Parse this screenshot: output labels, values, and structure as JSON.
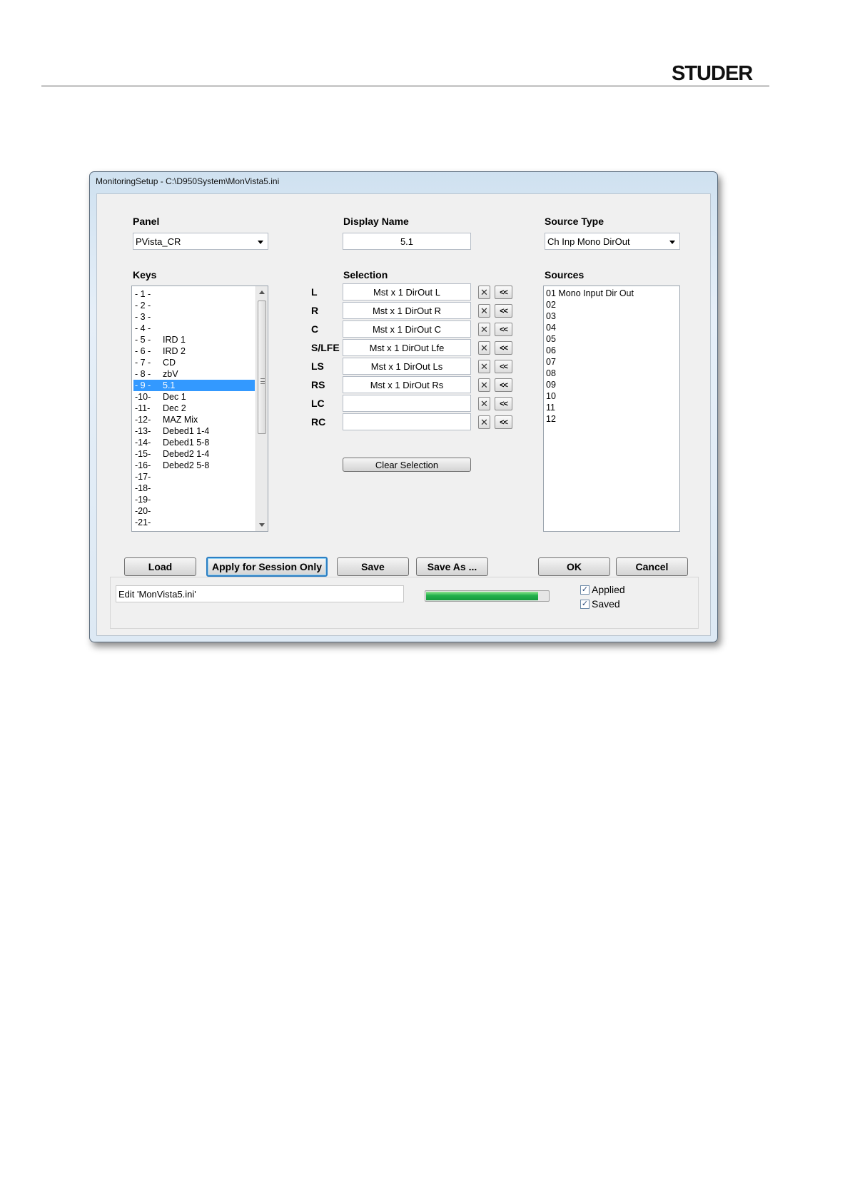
{
  "brand": {
    "logo_text": "STUDER"
  },
  "window": {
    "title": "MonitoringSetup - C:\\D950System\\MonVista5.ini"
  },
  "panel": {
    "label": "Panel",
    "value": "PVista_CR"
  },
  "display_name": {
    "label": "Display Name",
    "value": "5.1"
  },
  "source_type": {
    "label": "Source Type",
    "value": "Ch Inp Mono DirOut"
  },
  "keys": {
    "label": "Keys",
    "items": [
      {
        "num": "- 1 -",
        "name": ""
      },
      {
        "num": "- 2 -",
        "name": ""
      },
      {
        "num": "- 3 -",
        "name": ""
      },
      {
        "num": "- 4 -",
        "name": ""
      },
      {
        "num": "- 5 -",
        "name": "IRD 1"
      },
      {
        "num": "- 6 -",
        "name": "IRD 2"
      },
      {
        "num": "- 7 -",
        "name": "CD"
      },
      {
        "num": "- 8 -",
        "name": "zbV"
      },
      {
        "num": "- 9 -",
        "name": "5.1",
        "selected": true
      },
      {
        "num": "-10-",
        "name": "Dec 1"
      },
      {
        "num": "-11-",
        "name": "Dec 2"
      },
      {
        "num": "-12-",
        "name": "MAZ Mix"
      },
      {
        "num": "-13-",
        "name": "Debed1 1-4"
      },
      {
        "num": "-14-",
        "name": "Debed1 5-8"
      },
      {
        "num": "-15-",
        "name": "Debed2 1-4"
      },
      {
        "num": "-16-",
        "name": "Debed2 5-8"
      },
      {
        "num": "-17-",
        "name": ""
      },
      {
        "num": "-18-",
        "name": ""
      },
      {
        "num": "-19-",
        "name": ""
      },
      {
        "num": "-20-",
        "name": ""
      },
      {
        "num": "-21-",
        "name": ""
      }
    ]
  },
  "selection": {
    "label": "Selection",
    "rows": [
      {
        "channel": "L",
        "value": "Mst x 1 DirOut L"
      },
      {
        "channel": "R",
        "value": "Mst x 1 DirOut R"
      },
      {
        "channel": "C",
        "value": "Mst x 1 DirOut C"
      },
      {
        "channel": "S/LFE",
        "value": "Mst x 1 DirOut Lfe"
      },
      {
        "channel": "LS",
        "value": "Mst x 1 DirOut Ls"
      },
      {
        "channel": "RS",
        "value": "Mst x 1 DirOut Rs"
      },
      {
        "channel": "LC",
        "value": ""
      },
      {
        "channel": "RC",
        "value": ""
      }
    ],
    "clear_glyph": "✕",
    "assign_glyph": "<<",
    "clear_button": "Clear Selection"
  },
  "sources": {
    "label": "Sources",
    "items": [
      "01 Mono Input Dir Out",
      "02",
      "03",
      "04",
      "05",
      "06",
      "07",
      "08",
      "09",
      "10",
      "11",
      "12"
    ]
  },
  "buttons": {
    "load": "Load",
    "apply": "Apply for Session Only",
    "save": "Save",
    "save_as": "Save As ...",
    "ok": "OK",
    "cancel": "Cancel"
  },
  "status": {
    "text": "Edit 'MonVista5.ini'",
    "progress": 0.92,
    "applied": {
      "label": "Applied",
      "checked": true
    },
    "saved": {
      "label": "Saved",
      "checked": true
    }
  },
  "colors": {
    "selection": "#3399ff",
    "progress": "#22b14c",
    "accent": "#2d7fc3"
  }
}
